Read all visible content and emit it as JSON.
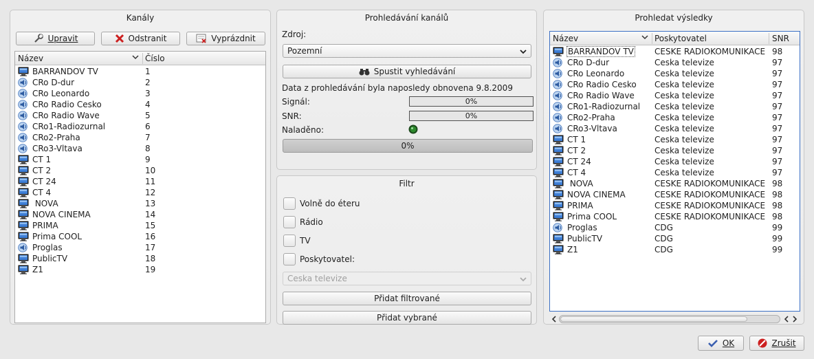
{
  "left": {
    "title": "Kanály",
    "buttons": {
      "edit": "Upravit",
      "remove": "Odstranit",
      "clear": "Vyprázdnit"
    },
    "columns": {
      "name": "Název",
      "number": "Číslo"
    },
    "rows": [
      {
        "icon": "tv",
        "name": "BARRANDOV TV",
        "num": "1"
      },
      {
        "icon": "radio",
        "name": "CRo D-dur",
        "num": "2"
      },
      {
        "icon": "radio",
        "name": "CRo Leonardo",
        "num": "3"
      },
      {
        "icon": "radio",
        "name": "CRo Radio Cesko",
        "num": "4"
      },
      {
        "icon": "radio",
        "name": "CRo Radio Wave",
        "num": "5"
      },
      {
        "icon": "radio",
        "name": "CRo1-Radiozurnal",
        "num": "6"
      },
      {
        "icon": "radio",
        "name": "CRo2-Praha",
        "num": "7"
      },
      {
        "icon": "radio",
        "name": "CRo3-Vltava",
        "num": "8"
      },
      {
        "icon": "tv",
        "name": "CT 1",
        "num": "9"
      },
      {
        "icon": "tv",
        "name": "CT 2",
        "num": "10"
      },
      {
        "icon": "tv",
        "name": "CT 24",
        "num": "11"
      },
      {
        "icon": "tv",
        "name": "CT 4",
        "num": "12"
      },
      {
        "icon": "tv",
        "name": " NOVA",
        "num": "13"
      },
      {
        "icon": "tv",
        "name": "NOVA CINEMA",
        "num": "14"
      },
      {
        "icon": "tv",
        "name": "PRIMA",
        "num": "15"
      },
      {
        "icon": "tv",
        "name": "Prima COOL",
        "num": "16"
      },
      {
        "icon": "radio",
        "name": "Proglas",
        "num": "17"
      },
      {
        "icon": "tv",
        "name": "PublicTV",
        "num": "18"
      },
      {
        "icon": "tv",
        "name": "Z1",
        "num": "19"
      }
    ]
  },
  "scan": {
    "title": "Prohledávání kanálů",
    "source_label": "Zdroj:",
    "source_value": "Pozemní",
    "start_button": "Spustit vyhledávání",
    "updated_text": "Data z prohledávání byla naposledy obnovena 9.8.2009",
    "signal_label": "Signál:",
    "signal_value": "0%",
    "snr_label": "SNR:",
    "snr_value": "0%",
    "tuned_label": "Naladěno:",
    "progress_value": "0%"
  },
  "filter": {
    "title": "Filtr",
    "options": [
      "Volně do éteru",
      "Rádio",
      "TV",
      "Poskytovatel:"
    ],
    "provider_value": "Ceska televize",
    "add_filtered": "Přidat filtrované",
    "add_selected": "Přidat vybrané"
  },
  "results": {
    "title": "Prohledat výsledky",
    "columns": {
      "name": "Název",
      "provider": "Poskytovatel",
      "snr": "SNR"
    },
    "rows": [
      {
        "icon": "tv",
        "name": "BARRANDOV TV",
        "provider": "CESKE RADIOKOMUNIKACE",
        "snr": "98"
      },
      {
        "icon": "radio",
        "name": "CRo D-dur",
        "provider": "Ceska televize",
        "snr": "97"
      },
      {
        "icon": "radio",
        "name": "CRo Leonardo",
        "provider": "Ceska televize",
        "snr": "97"
      },
      {
        "icon": "radio",
        "name": "CRo Radio Cesko",
        "provider": "Ceska televize",
        "snr": "97"
      },
      {
        "icon": "radio",
        "name": "CRo Radio Wave",
        "provider": "Ceska televize",
        "snr": "97"
      },
      {
        "icon": "radio",
        "name": "CRo1-Radiozurnal",
        "provider": "Ceska televize",
        "snr": "97"
      },
      {
        "icon": "radio",
        "name": "CRo2-Praha",
        "provider": "Ceska televize",
        "snr": "97"
      },
      {
        "icon": "radio",
        "name": "CRo3-Vltava",
        "provider": "Ceska televize",
        "snr": "97"
      },
      {
        "icon": "tv",
        "name": "CT 1",
        "provider": "Ceska televize",
        "snr": "97"
      },
      {
        "icon": "tv",
        "name": "CT 2",
        "provider": "Ceska televize",
        "snr": "97"
      },
      {
        "icon": "tv",
        "name": "CT 24",
        "provider": "Ceska televize",
        "snr": "97"
      },
      {
        "icon": "tv",
        "name": "CT 4",
        "provider": "Ceska televize",
        "snr": "97"
      },
      {
        "icon": "tv",
        "name": " NOVA",
        "provider": "CESKE RADIOKOMUNIKACE",
        "snr": "98"
      },
      {
        "icon": "tv",
        "name": "NOVA CINEMA",
        "provider": "CESKE RADIOKOMUNIKACE",
        "snr": "98"
      },
      {
        "icon": "tv",
        "name": "PRIMA",
        "provider": "CESKE RADIOKOMUNIKACE",
        "snr": "98"
      },
      {
        "icon": "tv",
        "name": "Prima COOL",
        "provider": "CESKE RADIOKOMUNIKACE",
        "snr": "98"
      },
      {
        "icon": "radio",
        "name": "Proglas",
        "provider": "CDG",
        "snr": "99"
      },
      {
        "icon": "tv",
        "name": "PublicTV",
        "provider": "CDG",
        "snr": "99"
      },
      {
        "icon": "tv",
        "name": "Z1",
        "provider": "CDG",
        "snr": "99"
      }
    ]
  },
  "dialog": {
    "ok": "OK",
    "cancel": "Zrušit"
  },
  "colors": {
    "accent": "#3b6fc4",
    "tuned_led": "#2e8b2e"
  }
}
